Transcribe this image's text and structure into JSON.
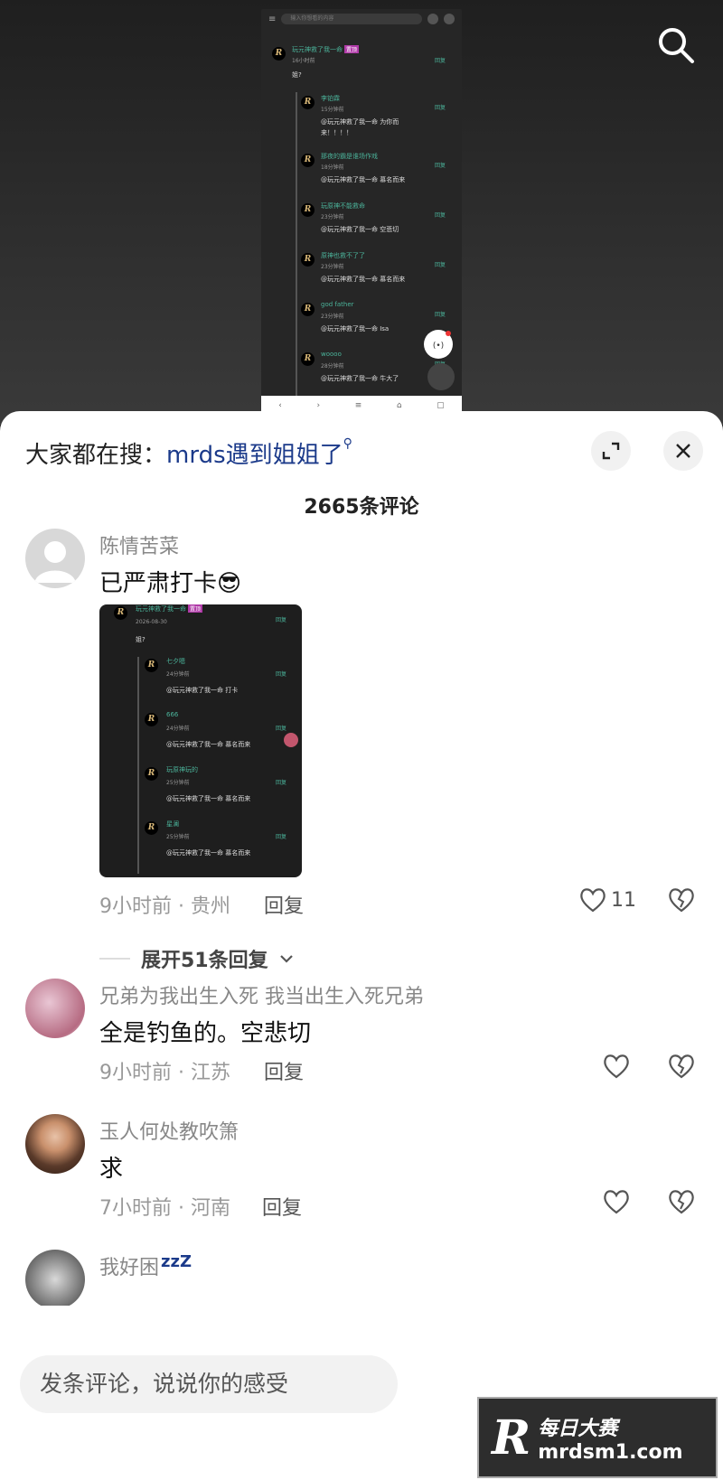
{
  "screenshot": {
    "search_placeholder": "输入你想看的内容",
    "main_comment": {
      "user": "玩元神救了我一命",
      "tag": "置顶",
      "time": "16小时前",
      "text": "姐?",
      "reply": "回复"
    },
    "replies": [
      {
        "user": "李铂霖",
        "time": "15分钟前",
        "text1": "@玩元神救了我一命 为你而",
        "text2": "来！！！！",
        "reply": "回复"
      },
      {
        "user": "那夜的霸是谁场作戏",
        "time": "18分钟前",
        "text1": "@玩元神救了我一命 慕名而来",
        "text2": "",
        "reply": "回复"
      },
      {
        "user": "玩原神不能救命",
        "time": "23分钟前",
        "text1": "@玩元神救了我一命 空悲切",
        "text2": "",
        "reply": "回复"
      },
      {
        "user": "原神也救不了了",
        "time": "23分钟前",
        "text1": "@玩元神救了我一命 慕名而来",
        "text2": "",
        "reply": "回复"
      },
      {
        "user": "god father",
        "time": "23分钟前",
        "text1": "@玩元神救了我一命 Isa",
        "text2": "",
        "reply": "回复"
      },
      {
        "user": "woooo",
        "time": "28分钟前",
        "text1": "@玩元神救了我一命 牛大了",
        "text2": "",
        "reply": "回复"
      }
    ]
  },
  "header": {
    "hot_search_prefix": "大家都在搜：",
    "hot_search_term": "mrds遇到姐姐了",
    "comment_count": "2665条评论"
  },
  "comments": [
    {
      "user": "陈情苦菜",
      "text": "已严肃打卡😎",
      "time_location": "9小时前 · 贵州",
      "reply_label": "回复",
      "likes": "11",
      "expand_label": "展开51条回复",
      "embed": {
        "main": {
          "user": "玩元神救了我一命",
          "tag": "置顶",
          "time": "2026-08-30",
          "text": "姐?",
          "reply": "回复"
        },
        "replies": [
          {
            "user": "七夕嗯",
            "time": "24分钟前",
            "text": "@玩元神救了我一命 打卡",
            "reply": "回复"
          },
          {
            "user": "666",
            "time": "24分钟前",
            "text": "@玩元神救了我一命 慕名而来",
            "reply": "回复"
          },
          {
            "user": "玩原神玩的",
            "time": "25分钟前",
            "text": "@玩元神救了我一命 慕名而来",
            "reply": "回复"
          },
          {
            "user": "星澜",
            "time": "25分钟前",
            "text": "@玩元神救了我一命 慕名而来",
            "reply": "回复"
          }
        ]
      }
    },
    {
      "user": "兄弟为我出生入死 我当出生入死兄弟",
      "text": "全是钓鱼的。空悲切",
      "time_location": "9小时前 · 江苏",
      "reply_label": "回复",
      "likes": ""
    },
    {
      "user": "玉人何处教吹箫",
      "text": "求",
      "time_location": "7小时前 · 河南",
      "reply_label": "回复",
      "likes": ""
    },
    {
      "user": "我好困",
      "user_suffix": "zzZ",
      "text": "",
      "time_location": "",
      "reply_label": "",
      "likes": ""
    }
  ],
  "input": {
    "placeholder": "发条评论，说说你的感受"
  },
  "watermark": {
    "logo": "R",
    "line1": "每日大赛",
    "line2": "mrdsm1.com"
  },
  "colors": {
    "link": "#1b3a8a",
    "reply_green": "#4bb39a",
    "tag": "#b03aa8",
    "sheet_bg": "#ffffff"
  }
}
